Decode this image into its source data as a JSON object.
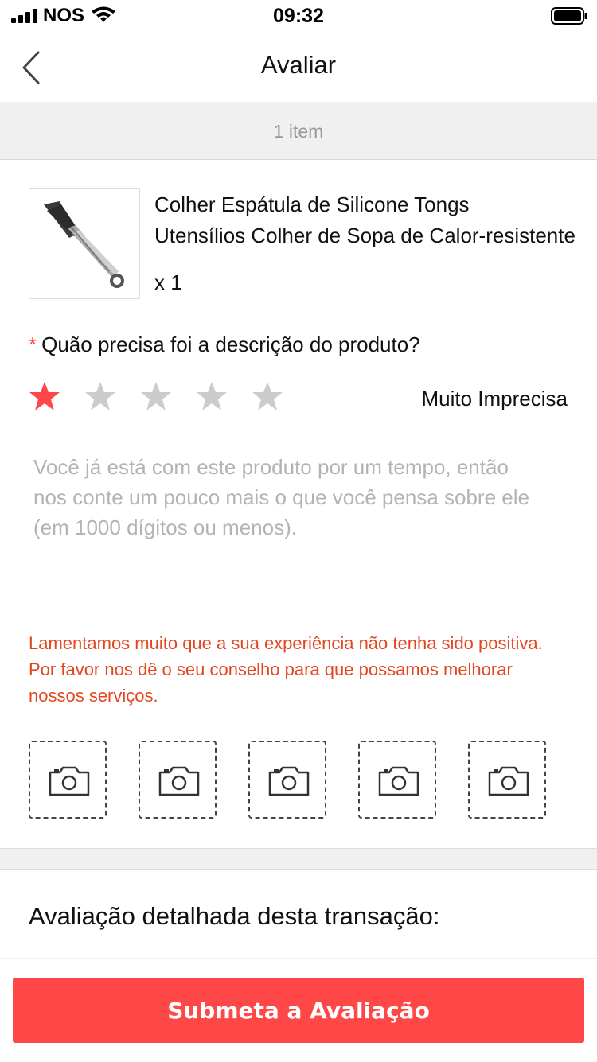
{
  "status_bar": {
    "carrier": "NOS",
    "time": "09:32"
  },
  "nav": {
    "title": "Avaliar",
    "back_icon": "chevron-left-icon"
  },
  "summary": {
    "item_count": "1 item"
  },
  "product": {
    "title_line1": "Colher Espátula de Silicone Tongs",
    "title_line2": "Utensílios Colher de Sopa de Calor-resistente",
    "quantity": "x 1"
  },
  "rating": {
    "required_mark": "*",
    "question": "Quão precisa foi a descrição do produto?",
    "value": 1,
    "max": 5,
    "label": "Muito Imprecisa",
    "active_color": "#ff4747",
    "inactive_color": "#cccccc"
  },
  "comment": {
    "placeholder": "Você já está com este produto por um tempo, então nos conte um pouco mais o que você pensa sobre ele (em 1000 dígitos ou menos)."
  },
  "warning": {
    "text": "Lamentamos muito que a sua experiência não tenha sido positiva. Por favor nos dê o seu conselho para que possamos melhorar nossos serviços.",
    "color": "#e4461f"
  },
  "photos": {
    "slot_count": 5,
    "icon": "camera-icon"
  },
  "detail": {
    "heading": "Avaliação detalhada desta transação:"
  },
  "footer": {
    "submit_label": "Submeta a Avaliação",
    "button_color": "#ff4747"
  }
}
